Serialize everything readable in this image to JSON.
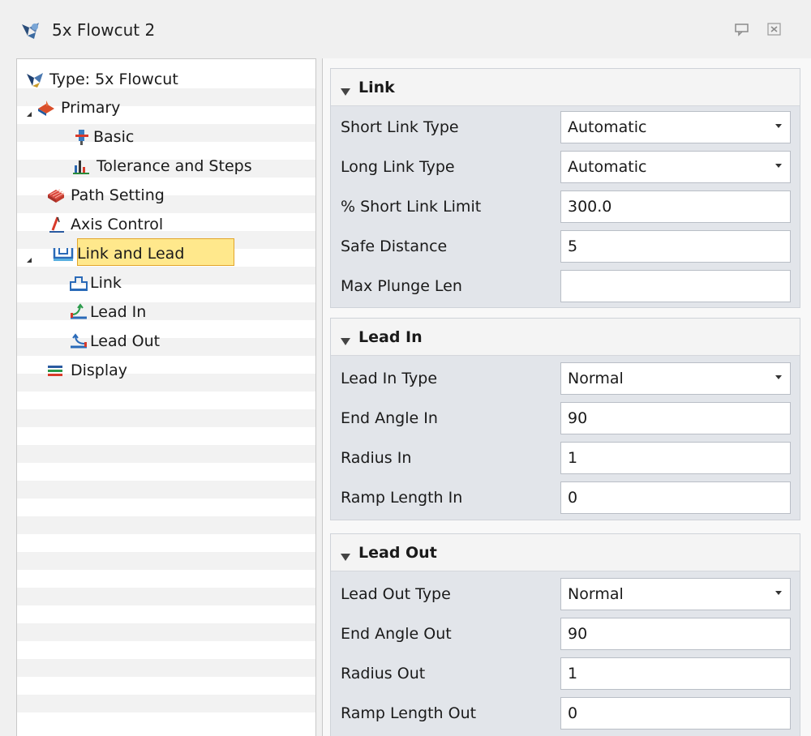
{
  "window": {
    "title": "5x Flowcut 2",
    "icons": {
      "app": "flowcut-app-icon",
      "pin": "pin-icon",
      "close": "close-icon"
    }
  },
  "tree": {
    "items": [
      {
        "label": "Type: 5x Flowcut",
        "icon": "flowcut-type-icon"
      },
      {
        "label": "Primary",
        "icon": "primary-icon",
        "expanded": true
      },
      {
        "label": "Basic",
        "icon": "basic-icon"
      },
      {
        "label": "Tolerance and Steps",
        "icon": "tolerance-icon"
      },
      {
        "label": "Path Setting",
        "icon": "path-setting-icon"
      },
      {
        "label": "Axis Control",
        "icon": "axis-control-icon"
      },
      {
        "label": "Link and Lead",
        "icon": "link-lead-icon",
        "expanded": true,
        "selected": true
      },
      {
        "label": "Link",
        "icon": "link-icon"
      },
      {
        "label": "Lead In",
        "icon": "lead-in-icon"
      },
      {
        "label": "Lead Out",
        "icon": "lead-out-icon"
      },
      {
        "label": "Display",
        "icon": "display-icon"
      }
    ]
  },
  "groups": {
    "link": {
      "title": "Link",
      "rows": [
        {
          "label": "Short Link Type",
          "value": "Automatic",
          "dropdown": true
        },
        {
          "label": "Long Link Type",
          "value": "Automatic",
          "dropdown": true
        },
        {
          "label": "% Short Link Limit",
          "value": "300.0"
        },
        {
          "label": "Safe Distance",
          "value": "5"
        },
        {
          "label": "Max Plunge Len",
          "value": ""
        }
      ]
    },
    "lead_in": {
      "title": "Lead In",
      "rows": [
        {
          "label": "Lead In Type",
          "value": "Normal",
          "dropdown": true
        },
        {
          "label": "End Angle In",
          "value": "90"
        },
        {
          "label": "Radius In",
          "value": "1"
        },
        {
          "label": "Ramp Length In",
          "value": "0"
        }
      ]
    },
    "lead_out": {
      "title": "Lead Out",
      "rows": [
        {
          "label": "Lead Out Type",
          "value": "Normal",
          "dropdown": true
        },
        {
          "label": "End Angle Out",
          "value": "90"
        },
        {
          "label": "Radius Out",
          "value": "1"
        },
        {
          "label": "Ramp Length Out",
          "value": "0"
        }
      ]
    }
  },
  "colors": {
    "selection_fill": "#ffe88c",
    "selection_border": "#e2a52c",
    "group_bg": "#e2e5ea",
    "panel_bg": "#f0f0f0"
  }
}
